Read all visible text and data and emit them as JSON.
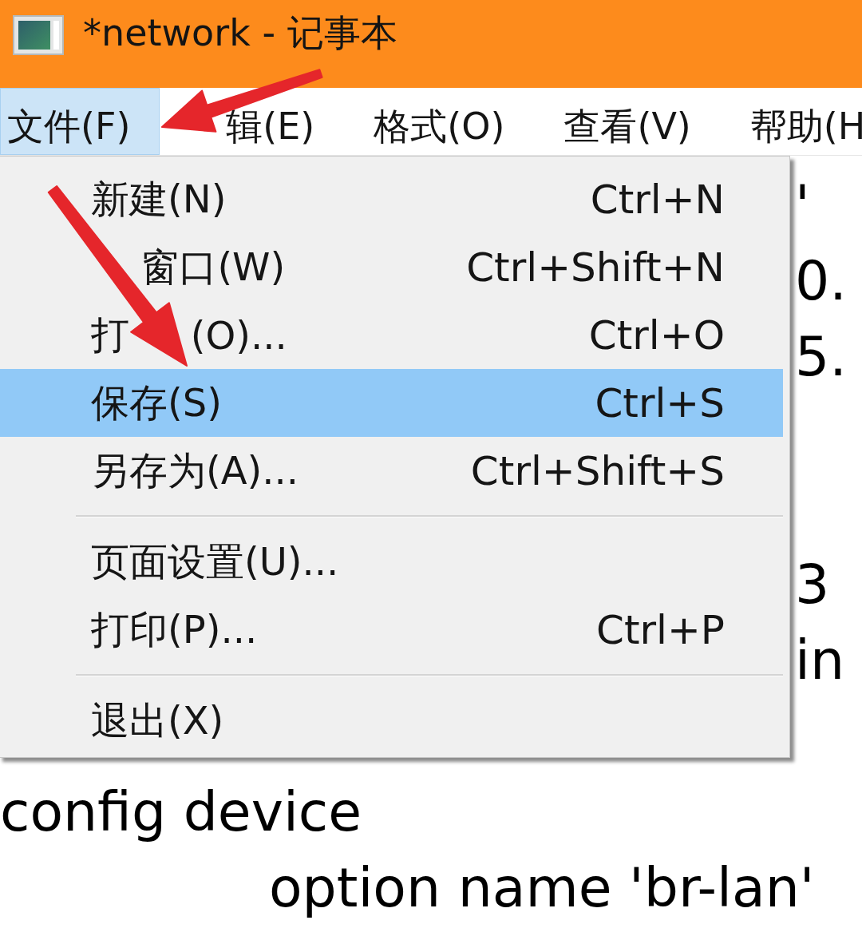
{
  "window": {
    "title": "*network - 记事本"
  },
  "menu_bar": [
    {
      "label": "文件(F)",
      "selected": true
    },
    {
      "label_parts": [
        {
          "kind": "covered"
        },
        {
          "kind": "text",
          "text": "辑(E)"
        }
      ],
      "selected": false
    },
    {
      "label": "格式(O)",
      "selected": false
    },
    {
      "label": "查看(V)",
      "selected": false
    },
    {
      "label": "帮助(H",
      "selected": false
    }
  ],
  "file_menu": {
    "items": [
      {
        "kind": "command",
        "label": "新建(N)",
        "shortcut": "Ctrl+N",
        "selected": false
      },
      {
        "kind": "command",
        "label_parts": [
          {
            "kind": "covered"
          },
          {
            "kind": "text",
            "text": "窗口(W)"
          }
        ],
        "shortcut": "Ctrl+Shift+N",
        "selected": false
      },
      {
        "kind": "command",
        "label_parts": [
          {
            "kind": "text",
            "text": "打"
          },
          {
            "kind": "covered"
          },
          {
            "kind": "text",
            "text": "(O)..."
          }
        ],
        "shortcut": "Ctrl+O",
        "selected": false
      },
      {
        "kind": "command",
        "label": "保存(S)",
        "shortcut": "Ctrl+S",
        "selected": true
      },
      {
        "kind": "command",
        "label": "另存为(A)...",
        "shortcut": "Ctrl+Shift+S",
        "selected": false
      },
      {
        "kind": "separator"
      },
      {
        "kind": "command",
        "label": "页面设置(U)...",
        "selected": false
      },
      {
        "kind": "command",
        "label": "打印(P)...",
        "shortcut": "Ctrl+P",
        "selected": false
      },
      {
        "kind": "separator"
      },
      {
        "kind": "command",
        "label": "退出(X)",
        "selected": false
      }
    ]
  },
  "editor": {
    "lines": [
      {
        "kind": "tail",
        "text": "'"
      },
      {
        "kind": "tail",
        "text": "0."
      },
      {
        "kind": "tail",
        "text": "5."
      },
      {
        "kind": "covered"
      },
      {
        "kind": "covered"
      },
      {
        "kind": "tail",
        "text": "3"
      },
      {
        "kind": "tail",
        "text": "in"
      },
      {
        "kind": "covered"
      },
      {
        "kind": "line",
        "text": "config device",
        "children": [
          {
            "kind": "line",
            "text": "option name 'br-lan'"
          }
        ]
      }
    ]
  }
}
